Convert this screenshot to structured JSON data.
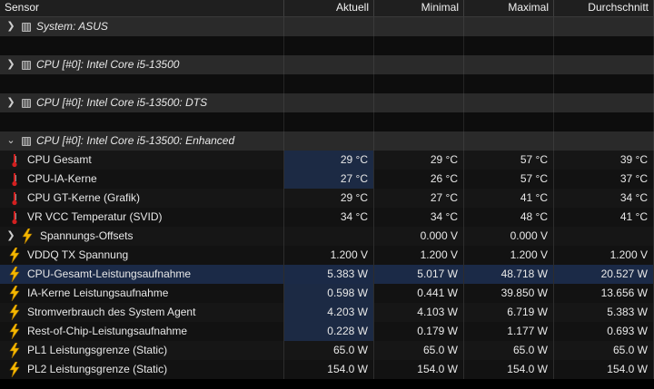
{
  "columns": [
    "Sensor",
    "Aktuell",
    "Minimal",
    "Maximal",
    "Durchschnitt"
  ],
  "groups": [
    {
      "label": "System: ASUS",
      "expanded": false
    },
    {
      "label": "CPU [#0]: Intel Core i5-13500",
      "expanded": false
    },
    {
      "label": "CPU [#0]: Intel Core i5-13500: DTS",
      "expanded": false
    },
    {
      "label": "CPU [#0]: Intel Core i5-13500: Enhanced",
      "expanded": true
    }
  ],
  "rows": [
    {
      "icon": "thermometer-icon",
      "label": "CPU Gesamt",
      "cur": "29 °C",
      "min": "29 °C",
      "max": "57 °C",
      "avg": "39 °C",
      "hl": true
    },
    {
      "icon": "thermometer-icon",
      "label": "CPU-IA-Kerne",
      "cur": "27 °C",
      "min": "26 °C",
      "max": "57 °C",
      "avg": "37 °C",
      "hl": true
    },
    {
      "icon": "thermometer-icon",
      "label": "CPU GT-Kerne (Grafik)",
      "cur": "29 °C",
      "min": "27 °C",
      "max": "41 °C",
      "avg": "34 °C"
    },
    {
      "icon": "thermometer-icon",
      "label": "VR VCC Temperatur (SVID)",
      "cur": "34 °C",
      "min": "34 °C",
      "max": "48 °C",
      "avg": "41 °C"
    },
    {
      "icon": "bolt-icon",
      "label": "Spannungs-Offsets",
      "cur": "",
      "min": "0.000 V",
      "max": "0.000 V",
      "avg": "",
      "sub": true
    },
    {
      "icon": "bolt-icon",
      "label": "VDDQ TX Spannung",
      "cur": "1.200 V",
      "min": "1.200 V",
      "max": "1.200 V",
      "avg": "1.200 V"
    },
    {
      "icon": "bolt-icon",
      "label": "CPU-Gesamt-Leistungsaufnahme",
      "cur": "5.383 W",
      "min": "5.017 W",
      "max": "48.718 W",
      "avg": "20.527 W",
      "selected": true
    },
    {
      "icon": "bolt-icon",
      "label": "IA-Kerne Leistungsaufnahme",
      "cur": "0.598 W",
      "min": "0.441 W",
      "max": "39.850 W",
      "avg": "13.656 W",
      "hl": true
    },
    {
      "icon": "bolt-icon",
      "label": "Stromverbrauch des System Agent",
      "cur": "4.203 W",
      "min": "4.103 W",
      "max": "6.719 W",
      "avg": "5.383 W",
      "hl": true
    },
    {
      "icon": "bolt-icon",
      "label": "Rest-of-Chip-Leistungsaufnahme",
      "cur": "0.228 W",
      "min": "0.179 W",
      "max": "1.177 W",
      "avg": "0.693 W",
      "hl": true
    },
    {
      "icon": "bolt-icon",
      "label": "PL1 Leistungsgrenze (Static)",
      "cur": "65.0 W",
      "min": "65.0 W",
      "max": "65.0 W",
      "avg": "65.0 W"
    },
    {
      "icon": "bolt-icon",
      "label": "PL2 Leistungsgrenze (Static)",
      "cur": "154.0 W",
      "min": "154.0 W",
      "max": "154.0 W",
      "avg": "154.0 W"
    }
  ],
  "colors": {
    "thermometer": "#d22020",
    "bolt": "#f5b800",
    "selection": "#1b2a47"
  }
}
